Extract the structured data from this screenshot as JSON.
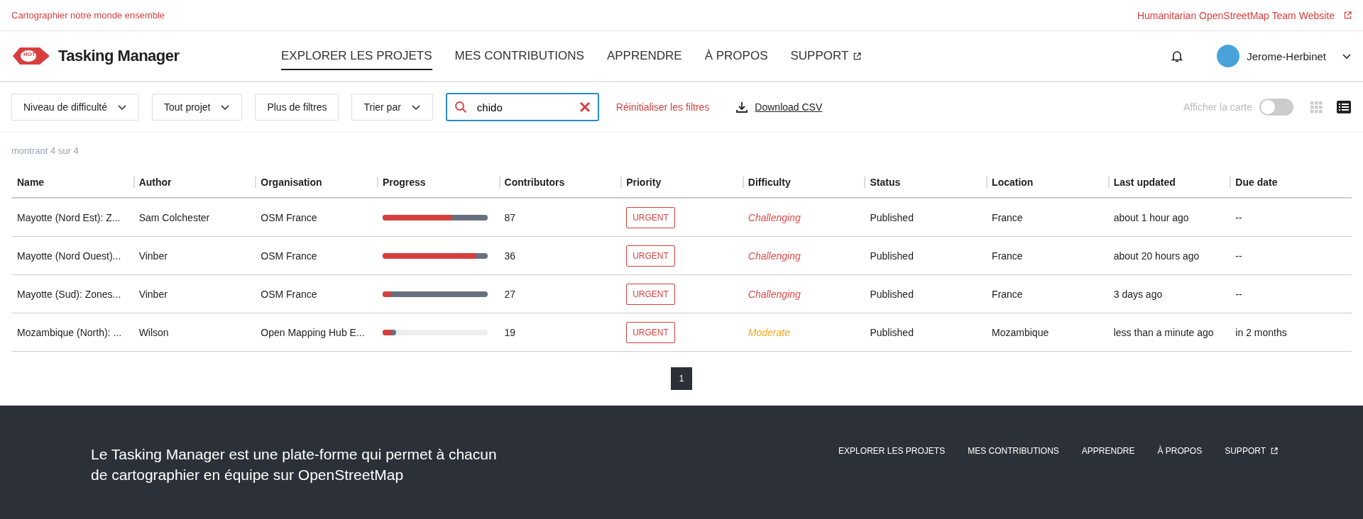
{
  "top_bar": {
    "tagline": "Cartographier notre monde ensemble",
    "site_link": "Humanitarian OpenStreetMap Team Website"
  },
  "header": {
    "logo_badge": "HOT",
    "app_name": "Tasking Manager",
    "nav": [
      {
        "label": "EXPLORER LES PROJETS",
        "selected": true,
        "external": false
      },
      {
        "label": "MES CONTRIBUTIONS",
        "selected": false,
        "external": false
      },
      {
        "label": "APPRENDRE",
        "selected": false,
        "external": false
      },
      {
        "label": "À PROPOS",
        "selected": false,
        "external": false
      },
      {
        "label": "SUPPORT",
        "selected": false,
        "external": true
      }
    ],
    "user": "Jerome-Herbinet"
  },
  "filters": {
    "dropdowns": [
      {
        "label": "Niveau de difficulté",
        "dropdown": true
      },
      {
        "label": "Tout projet",
        "dropdown": true
      },
      {
        "label": "Plus de filtres",
        "dropdown": false
      },
      {
        "label": "Trier par",
        "dropdown": true
      }
    ],
    "search": {
      "value": "chido"
    },
    "reset": "Réinitialiser les filtres",
    "download": "Download CSV",
    "map_toggle": {
      "label": "Afficher la carte",
      "on": false
    },
    "view_buttons": [
      {
        "kind": "grid",
        "selected": false
      },
      {
        "kind": "list",
        "selected": true
      }
    ]
  },
  "count": "montrant 4 sur 4",
  "table": {
    "columns": [
      "Name",
      "Author",
      "Organisation",
      "Progress",
      "Contributors",
      "Priority",
      "Difficulty",
      "Status",
      "Location",
      "Last updated",
      "Due date"
    ],
    "rows": [
      {
        "name": "Mayotte (Nord Est): Z...",
        "author": "Sam Colchester",
        "organisation": "OSM France",
        "progress": {
          "mapped": {
            "level": 1
          },
          "validated": {
            "level": 0.66
          }
        },
        "contributors": "87",
        "priority": "URGENT",
        "difficulty": {
          "text": "Challenging",
          "color": "#e04a4a"
        },
        "status": "Published",
        "location": "France",
        "last_updated": "about 1 hour ago",
        "due_date": "--"
      },
      {
        "name": "Mayotte (Nord Ouest)...",
        "author": "Vinber",
        "organisation": "OSM France",
        "progress": {
          "mapped": {
            "level": 1
          },
          "validated": {
            "level": 0.89
          }
        },
        "contributors": "36",
        "priority": "URGENT",
        "difficulty": {
          "text": "Challenging",
          "color": "#e04a4a"
        },
        "status": "Published",
        "location": "France",
        "last_updated": "about 20 hours ago",
        "due_date": "--"
      },
      {
        "name": "Mayotte (Sud): Zones...",
        "author": "Vinber",
        "organisation": "OSM France",
        "progress": {
          "mapped": {
            "level": 1
          },
          "validated": {
            "level": 0.08
          }
        },
        "contributors": "27",
        "priority": "URGENT",
        "difficulty": {
          "text": "Challenging",
          "color": "#e04a4a"
        },
        "status": "Published",
        "location": "France",
        "last_updated": "3 days ago",
        "due_date": "--"
      },
      {
        "name": "Mozambique (North): ...",
        "author": "Wilson",
        "organisation": "Open Mapping Hub E...",
        "progress": {
          "mapped": {
            "level": 0.13
          },
          "validated": {
            "level": 0.09
          }
        },
        "contributors": "19",
        "priority": "URGENT",
        "difficulty": {
          "text": "Moderate",
          "color": "#f5a623"
        },
        "status": "Published",
        "location": "Mozambique",
        "last_updated": "less than a minute ago",
        "due_date": "in 2 months"
      }
    ]
  },
  "pagination": [
    {
      "label": "1",
      "selected": true
    }
  ],
  "footer": {
    "text": "Le Tasking Manager est une plate-forme qui permet à chacun de cartographier en équipe sur OpenStreetMap",
    "links": [
      {
        "label": "EXPLORER LES PROJETS",
        "external": false
      },
      {
        "label": "MES CONTRIBUTIONS",
        "external": false
      },
      {
        "label": "APPRENDRE",
        "external": false
      },
      {
        "label": "À PROPOS",
        "external": false
      },
      {
        "label": "SUPPORT",
        "external": true
      }
    ]
  }
}
